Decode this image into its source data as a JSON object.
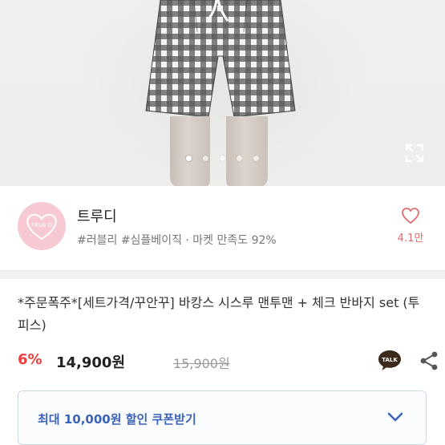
{
  "seller": {
    "name": "트루디",
    "logo_text": "TRUE D",
    "tags": "#러블리 #심플베이직 · 마켓 만족도 92%",
    "likes": "4.1만"
  },
  "carousel": {
    "total": 5,
    "active": 1
  },
  "product": {
    "title": "*주문폭주*[세트가격/꾸안꾸] 바캉스 시스루 맨투맨 + 체크 반바지 set (투피스)",
    "discount": "6%",
    "price": "14,900원",
    "original_price": "15,900원",
    "talk_label": "TALK"
  },
  "coupon": {
    "label": "최대 10,000원 할인 쿠폰받기"
  },
  "colors": {
    "accent": "#3b63b8",
    "discount": "#f03e3e",
    "like": "#e06d6d"
  }
}
